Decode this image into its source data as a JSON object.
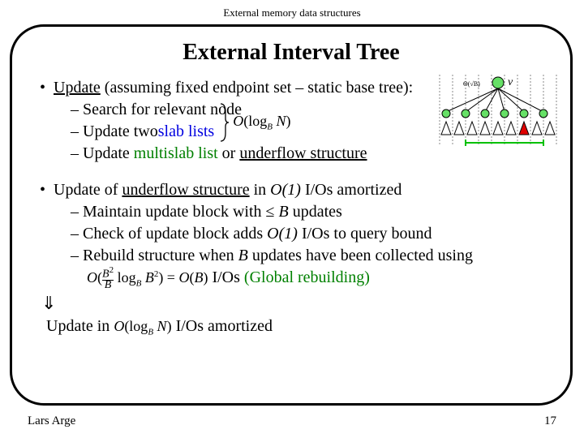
{
  "header": "External memory data structures",
  "title": "External Interval Tree",
  "p1": {
    "lead": "Update",
    "tail": " (assuming fixed endpoint set – static base tree):",
    "s1": "– Search for relevant node",
    "s2a": "– Update two ",
    "s2b": "slab lists",
    "s3a": "– Update ",
    "s3b": "multislab list",
    "s3c": " or ",
    "s3d": "underflow structure",
    "formula": "O(log_B N)"
  },
  "p2": {
    "a": "Update of ",
    "b": "underflow structure",
    "c": " in ",
    "d": "O(1)",
    "e": " I/Os amortized",
    "s1a": "– Maintain update block with ≤ ",
    "s1b": "B",
    "s1c": " updates",
    "s2a": "– Check of update block adds ",
    "s2b": "O(1)",
    "s2c": " I/Os to query bound",
    "s3a": "– Rebuild structure when ",
    "s3b": "B",
    "s3c": " updates have been collected using",
    "s4b": " I/Os ",
    "s4c": "(Global rebuilding)"
  },
  "p3": {
    "a": "Update in ",
    "c": " I/Os amortized"
  },
  "diagram": {
    "v": "v",
    "rootlabel": "Θ(√B)"
  },
  "footer": {
    "author": "Lars Arge",
    "page": "17"
  }
}
